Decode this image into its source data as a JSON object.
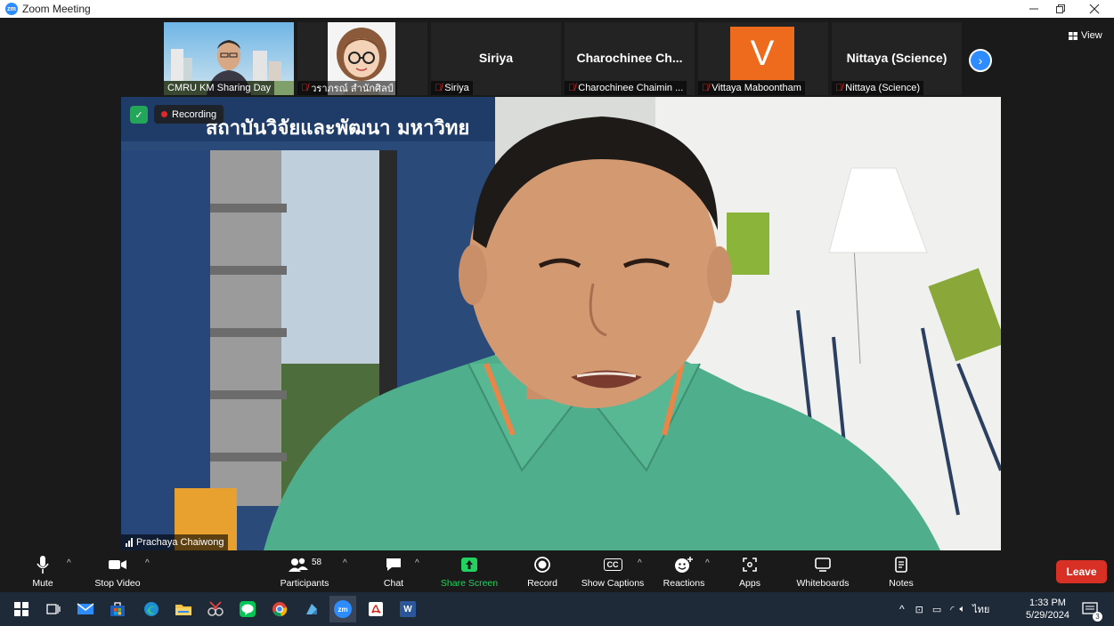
{
  "window": {
    "title": "Zoom Meeting",
    "logo_text": "zm"
  },
  "gallery": {
    "tiles": [
      {
        "label": "CMRU KM Sharing Day",
        "muted": false
      },
      {
        "label": "วราภรณ์ สำนักศิลป์",
        "muted": true
      },
      {
        "center_name": "Siriya",
        "label": "Siriya",
        "muted": true
      },
      {
        "center_name": "Charochinee Ch...",
        "label": "Charochinee Chaimin ...",
        "muted": true
      },
      {
        "avatar_letter": "V",
        "label": "Vittaya Maboontham",
        "muted": true
      },
      {
        "center_name": "Nittaya (Science)",
        "label": "Nittaya (Science)",
        "muted": true
      }
    ],
    "view_label": "View"
  },
  "main_video": {
    "recording_label": "Recording",
    "speaker_name": "Prachaya Chaiwong",
    "sign_text": "สถาบันวิจัยและพัฒนา มหาวิทย"
  },
  "toolbar": {
    "mute": "Mute",
    "stop_video": "Stop Video",
    "participants": "Participants",
    "participants_count": "58",
    "chat": "Chat",
    "share_screen": "Share Screen",
    "record": "Record",
    "show_captions": "Show Captions",
    "cc": "CC",
    "reactions": "Reactions",
    "apps": "Apps",
    "whiteboards": "Whiteboards",
    "notes": "Notes",
    "leave": "Leave"
  },
  "taskbar": {
    "time": "1:33 PM",
    "date": "5/29/2024",
    "language": "ไทย",
    "notification_count": "3",
    "zoom_icon_text": "zm",
    "word_icon_text": "W"
  },
  "colors": {
    "zoom_blue": "#2d8cff",
    "share_green": "#23d160",
    "leave_red": "#d93025",
    "muted_red": "#e02828",
    "shirt_green": "#4fae8c"
  }
}
